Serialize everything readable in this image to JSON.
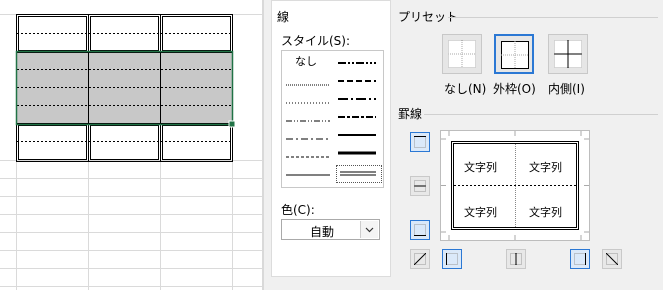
{
  "border_section": {
    "title": "線",
    "style_label": "スタイル(S):",
    "none_label": "なし",
    "color_label": "色(C):",
    "color_value": "自動"
  },
  "preset_section": {
    "title": "プリセット",
    "buttons": [
      {
        "label": "なし(N)",
        "icon": "preset-none-icon"
      },
      {
        "label": "外枠(O)",
        "icon": "preset-outline-icon",
        "selected": true
      },
      {
        "label": "内側(I)",
        "icon": "preset-inside-icon"
      }
    ]
  },
  "border_area": {
    "title": "罫線",
    "preview_text": [
      "文字列",
      "文字列",
      "文字列",
      "文字列"
    ]
  },
  "colors": {
    "accent": "#2b78d4",
    "selection_fill": "#c8c8c8",
    "selection_border": "#217346"
  }
}
